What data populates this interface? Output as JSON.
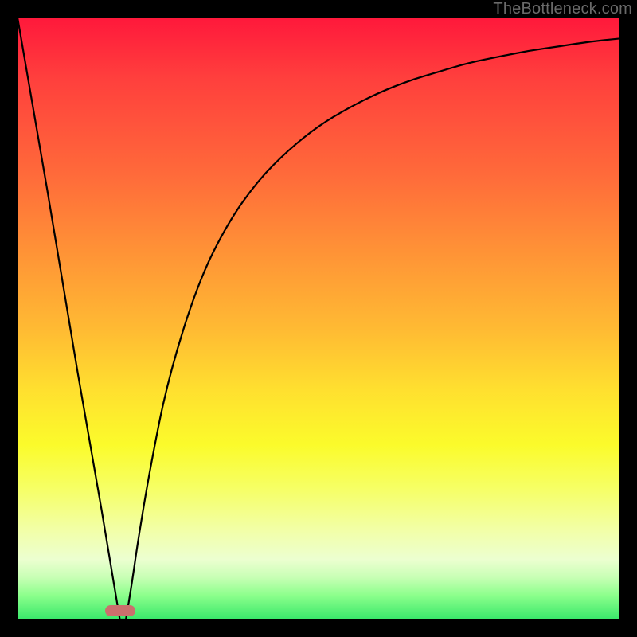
{
  "watermark": "TheBottleneck.com",
  "colors": {
    "frame": "#000000",
    "curve": "#000000",
    "marker": "#cb6f6d",
    "gradient_top": "#ff183b",
    "gradient_bottom": "#38e86a"
  },
  "chart_data": {
    "type": "line",
    "title": "",
    "xlabel": "",
    "ylabel": "",
    "xlim": [
      0,
      100
    ],
    "ylim": [
      0,
      100
    ],
    "x": [
      0,
      5,
      10,
      14,
      16,
      17,
      18,
      19,
      20,
      22,
      25,
      30,
      35,
      40,
      45,
      50,
      55,
      60,
      65,
      70,
      75,
      80,
      85,
      90,
      95,
      100
    ],
    "values": [
      100,
      71,
      41,
      18,
      6,
      0,
      0,
      6,
      13,
      25,
      40,
      56,
      66,
      73,
      78,
      82,
      85,
      87.5,
      89.5,
      91,
      92.5,
      93.5,
      94.5,
      95.2,
      96,
      96.5
    ],
    "marker_x": 17,
    "marker_y": 0
  }
}
